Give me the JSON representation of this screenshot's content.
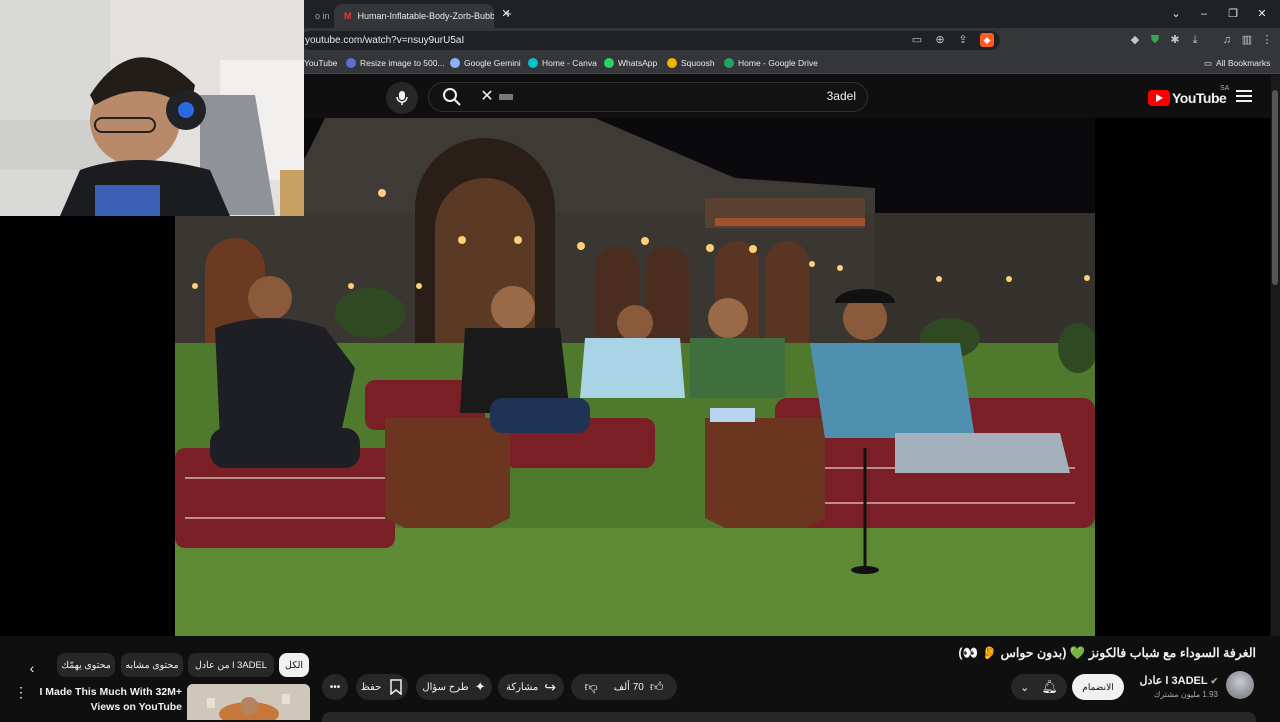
{
  "browser": {
    "tabs": [
      {
        "label": "o in"
      },
      {
        "label": "Human-Inflatable-Body-Zorb-Bubble",
        "favicon": "M"
      }
    ],
    "new_tab_label": "+",
    "window_controls": {
      "dropdown": "⌄",
      "minimize": "–",
      "restore": "❐",
      "close": "✕"
    },
    "url": "youtube.com/watch?v=nsuy9urU5aI",
    "bookmarks": [
      {
        "label": "YouTube",
        "color": "#ff0000"
      },
      {
        "label": "Resize image to 500...",
        "color": "#5f6bd8"
      },
      {
        "label": "Google Gemini",
        "color": "#8ab4f8"
      },
      {
        "label": "Home - Canva",
        "color": "#00c4cc"
      },
      {
        "label": "WhatsApp",
        "color": "#25d366"
      },
      {
        "label": "Squoosh",
        "color": "#f4b400"
      },
      {
        "label": "Home - Google Drive",
        "color": "#1fa463"
      }
    ],
    "all_bookmarks": "All Bookmarks"
  },
  "youtube": {
    "search_query": "3adel",
    "logo_text": "YouTube",
    "region": "SA"
  },
  "chips": {
    "all": "الكل",
    "from_channel": "من عادل l 3ADEL",
    "related": "محتوى مشابه",
    "interest": "محتوى يهمّك"
  },
  "video": {
    "title": "الغرفة السوداء مع شباب فالكونز 💚 (بدون حواس 👂 👀)",
    "channel_name": "عادل l 3ADEL",
    "subscribers": "1.93 مليون مشترك",
    "subscribe_label": "الانضمام",
    "like_count": "70 ألف",
    "share_label": "مشاركة",
    "ask_label": "طرح سؤال",
    "save_label": "حفظ",
    "more_label": "•••"
  },
  "recommendation": {
    "title": "I Made This Much With 32M+ Views on YouTube"
  },
  "colors": {
    "youtube_red": "#ff0000",
    "background": "#0f0f0f",
    "chip_bg": "#272727",
    "chip_active_bg": "#f1f1f1",
    "grass": "#4f7a2e",
    "stone_wall": "#3e3a36"
  }
}
